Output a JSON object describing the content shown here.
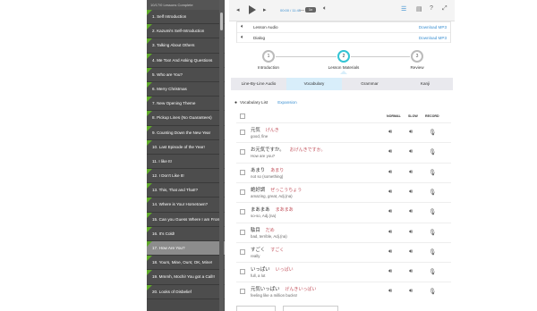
{
  "sidebar": {
    "progress_label": "10/17/0 Lessons Complete",
    "items": [
      {
        "label": "1. Self Introduction",
        "done": true,
        "active": false
      },
      {
        "label": "2. Kazumi's Self-Introduction",
        "done": true,
        "active": false
      },
      {
        "label": "3. Talking About Others",
        "done": true,
        "active": false
      },
      {
        "label": "4. Me Too! And Asking Questions",
        "done": true,
        "active": false
      },
      {
        "label": "5. Who are You?",
        "done": true,
        "active": false
      },
      {
        "label": "6. Merry Christmas",
        "done": true,
        "active": false
      },
      {
        "label": "7. New Opening Theme",
        "done": true,
        "active": false
      },
      {
        "label": "8. Pickup Lines (No Guarantees)",
        "done": true,
        "active": false
      },
      {
        "label": "9. Counting Down the New Year",
        "done": true,
        "active": false
      },
      {
        "label": "10. Last Episode of the Year!",
        "done": true,
        "active": false
      },
      {
        "label": "11. I like It!",
        "done": false,
        "active": false
      },
      {
        "label": "12. I Don't Like It!",
        "done": true,
        "active": false
      },
      {
        "label": "13. This, That and That!?",
        "done": true,
        "active": false
      },
      {
        "label": "14. Where is Your Hometown?",
        "done": true,
        "active": false
      },
      {
        "label": "15. Can you Guess Where I am From?",
        "done": true,
        "active": false
      },
      {
        "label": "16. It's Cold!",
        "done": true,
        "active": false
      },
      {
        "label": "17. How Are You?",
        "done": true,
        "active": true
      },
      {
        "label": "18. Yours, Mine, Ours; OK, Mine!",
        "done": true,
        "active": false
      },
      {
        "label": "19. Mmmh, Mochi! You got a Call!!",
        "done": true,
        "active": false
      },
      {
        "label": "20. Looks of Disbelief",
        "done": true,
        "active": false
      }
    ]
  },
  "player": {
    "time": "00:00 / 11:45",
    "speed": "1x",
    "icons": [
      "skip-back-icon",
      "play-icon",
      "skip-forward-icon",
      "volume-icon",
      "list-icon",
      "notes-icon",
      "help-icon",
      "expand-icon"
    ]
  },
  "audio": {
    "rows": [
      {
        "label": "Lesson Audio",
        "download": "Download MP3"
      },
      {
        "label": "Dialog",
        "download": "Download MP3"
      }
    ]
  },
  "steps": [
    {
      "num": "1",
      "label": "Introduction",
      "active": false
    },
    {
      "num": "2",
      "label": "Lesson Materials",
      "active": true
    },
    {
      "num": "3",
      "label": "Review",
      "active": false
    }
  ],
  "tabs": [
    {
      "label": "Line-By-Line Audio",
      "active": false
    },
    {
      "label": "Vocabulary",
      "active": true
    },
    {
      "label": "Grammar",
      "active": false
    },
    {
      "label": "Kanji",
      "active": false
    }
  ],
  "vocab": {
    "heading": "Vocabulary List",
    "expansion": "Expansion",
    "columns": [
      "NORMAL",
      "SLOW",
      "RECORD"
    ],
    "rows": [
      {
        "jp": "元気",
        "kana": "げんき",
        "en": "good, fine"
      },
      {
        "jp": "お元気ですか。",
        "kana": "おげんきですか。",
        "en": "How are you?"
      },
      {
        "jp": "あまり",
        "kana": "あまり",
        "en": "not so (something)"
      },
      {
        "jp": "絶好調",
        "kana": "ぜっこうちょう",
        "en": "amazing, great, Adj.(na)"
      },
      {
        "jp": "まあまあ",
        "kana": "まあまあ",
        "en": "so-so, Adj.(na)"
      },
      {
        "jp": "駄目",
        "kana": "だめ",
        "en": "bad, terrible, Adj.(na)"
      },
      {
        "jp": "すごく",
        "kana": "すごく",
        "en": "really"
      },
      {
        "jp": "いっぱい",
        "kana": "いっぱい",
        "en": "full, a lot"
      },
      {
        "jp": "元気いっぱい",
        "kana": "げんきいっぱい",
        "en": "feeling like a million bucks!"
      }
    ]
  },
  "colors": {
    "sidebar_bg": "#4a4a4a",
    "active_item": "#8c8c8c",
    "done_marker": "#5fa82a",
    "link": "#3a8fd1",
    "kana": "#c3545e",
    "step_active": "#33c4d4",
    "tab_active": "#d8eefa"
  }
}
